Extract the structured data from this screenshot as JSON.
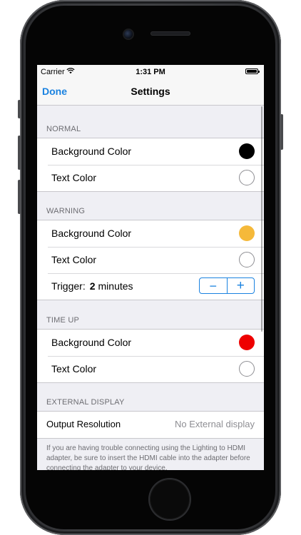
{
  "status_bar": {
    "carrier": "Carrier",
    "time": "1:31 PM"
  },
  "nav": {
    "done": "Done",
    "title": "Settings"
  },
  "sections": {
    "normal": {
      "header": "NORMAL",
      "background_label": "Background Color",
      "background_color": "#000000",
      "text_label": "Text Color",
      "text_color": "#ffffff"
    },
    "warning": {
      "header": "WARNING",
      "background_label": "Background Color",
      "background_color": "#f5b93a",
      "text_label": "Text Color",
      "text_color": "#ffffff",
      "trigger_label": "Trigger:",
      "trigger_value": "2",
      "trigger_unit": "minutes",
      "decrement": "−",
      "increment": "+"
    },
    "time_up": {
      "header": "TIME UP",
      "background_label": "Background Color",
      "background_color": "#ee0000",
      "text_label": "Text Color",
      "text_color": "#ffffff"
    },
    "external_display": {
      "header": "EXTERNAL DISPLAY",
      "output_label": "Output Resolution",
      "output_value": "No External display",
      "footer": "If you are having trouble connecting using the Lighting to HDMI adapter, be sure to insert the HDMI cable into the adapter before connecting the adapter to your device."
    }
  },
  "colors": {
    "accent": "#1a82e0",
    "group_background": "#efeff4"
  },
  "icons": [
    "wifi-icon",
    "battery-icon",
    "camera-icon",
    "speaker-icon",
    "home-button"
  ]
}
